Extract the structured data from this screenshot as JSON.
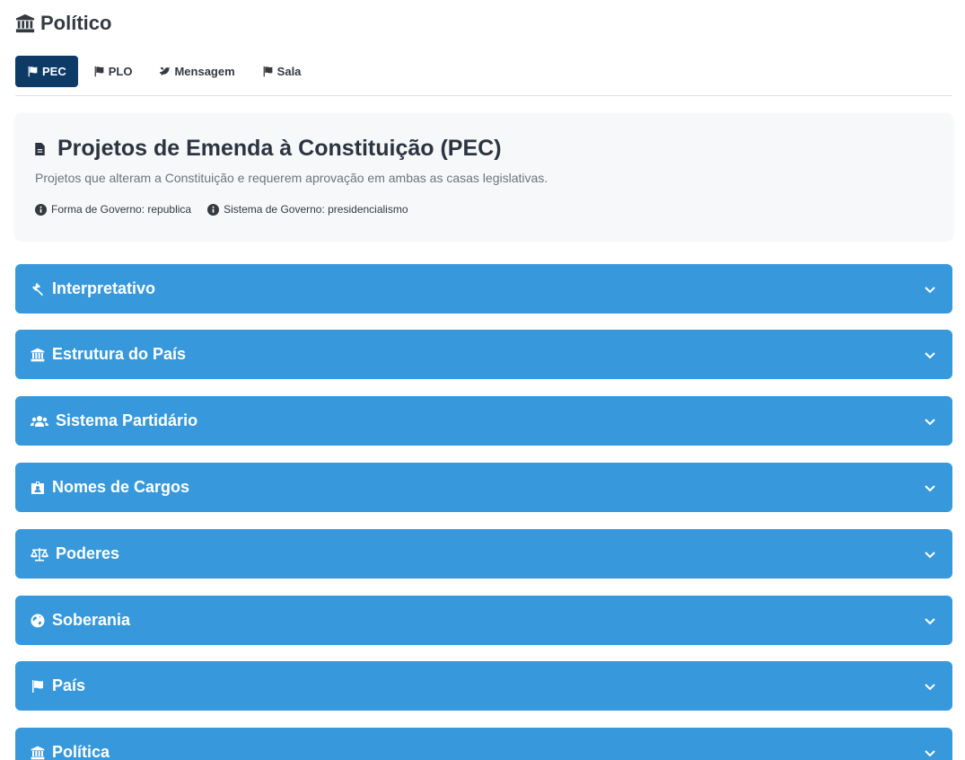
{
  "page": {
    "title": "Político"
  },
  "tabs": [
    {
      "label": "PEC",
      "icon": "flag-icon",
      "active": true
    },
    {
      "label": "PLO",
      "icon": "flag-icon",
      "active": false
    },
    {
      "label": "Mensagem",
      "icon": "dove-icon",
      "active": false
    },
    {
      "label": "Sala",
      "icon": "flag-icon",
      "active": false
    }
  ],
  "header": {
    "title": "Projetos de Emenda à Constituição (PEC)",
    "description": "Projetos que alteram a Constituição e requerem aprovação em ambas as casas legislativas.",
    "meta": [
      {
        "label": "Forma de Governo: republica"
      },
      {
        "label": "Sistema de Governo: presidencialismo"
      }
    ]
  },
  "sections": [
    {
      "label": "Interpretativo",
      "icon": "gavel-icon"
    },
    {
      "label": "Estrutura do País",
      "icon": "landmark-icon"
    },
    {
      "label": "Sistema Partidário",
      "icon": "users-icon"
    },
    {
      "label": "Nomes de Cargos",
      "icon": "id-badge-icon"
    },
    {
      "label": "Poderes",
      "icon": "balance-scale-icon"
    },
    {
      "label": "Soberania",
      "icon": "globe-icon"
    },
    {
      "label": "País",
      "icon": "flag-icon"
    },
    {
      "label": "Política",
      "icon": "landmark-icon"
    }
  ],
  "colors": {
    "accent": "#3799dc",
    "active_tab": "#0e3a66"
  }
}
